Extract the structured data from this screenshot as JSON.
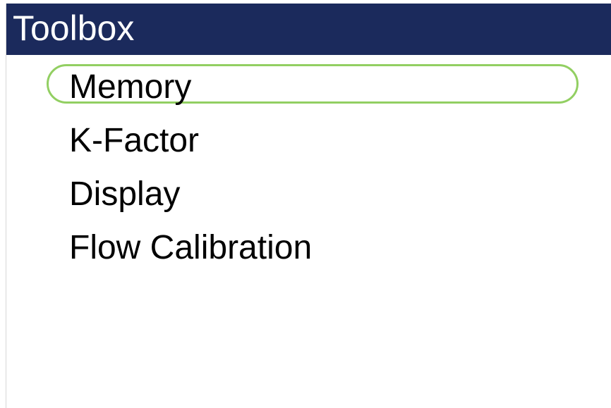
{
  "title_bar": {
    "title": "Toolbox",
    "background_color": "#1b2a5c",
    "text_color": "#ffffff"
  },
  "menu": {
    "items": [
      {
        "label": "Memory"
      },
      {
        "label": "K-Factor"
      },
      {
        "label": "Display"
      },
      {
        "label": "Flow Calibration"
      }
    ],
    "selected_label": "Memory",
    "selection_color": "#92cf62"
  }
}
